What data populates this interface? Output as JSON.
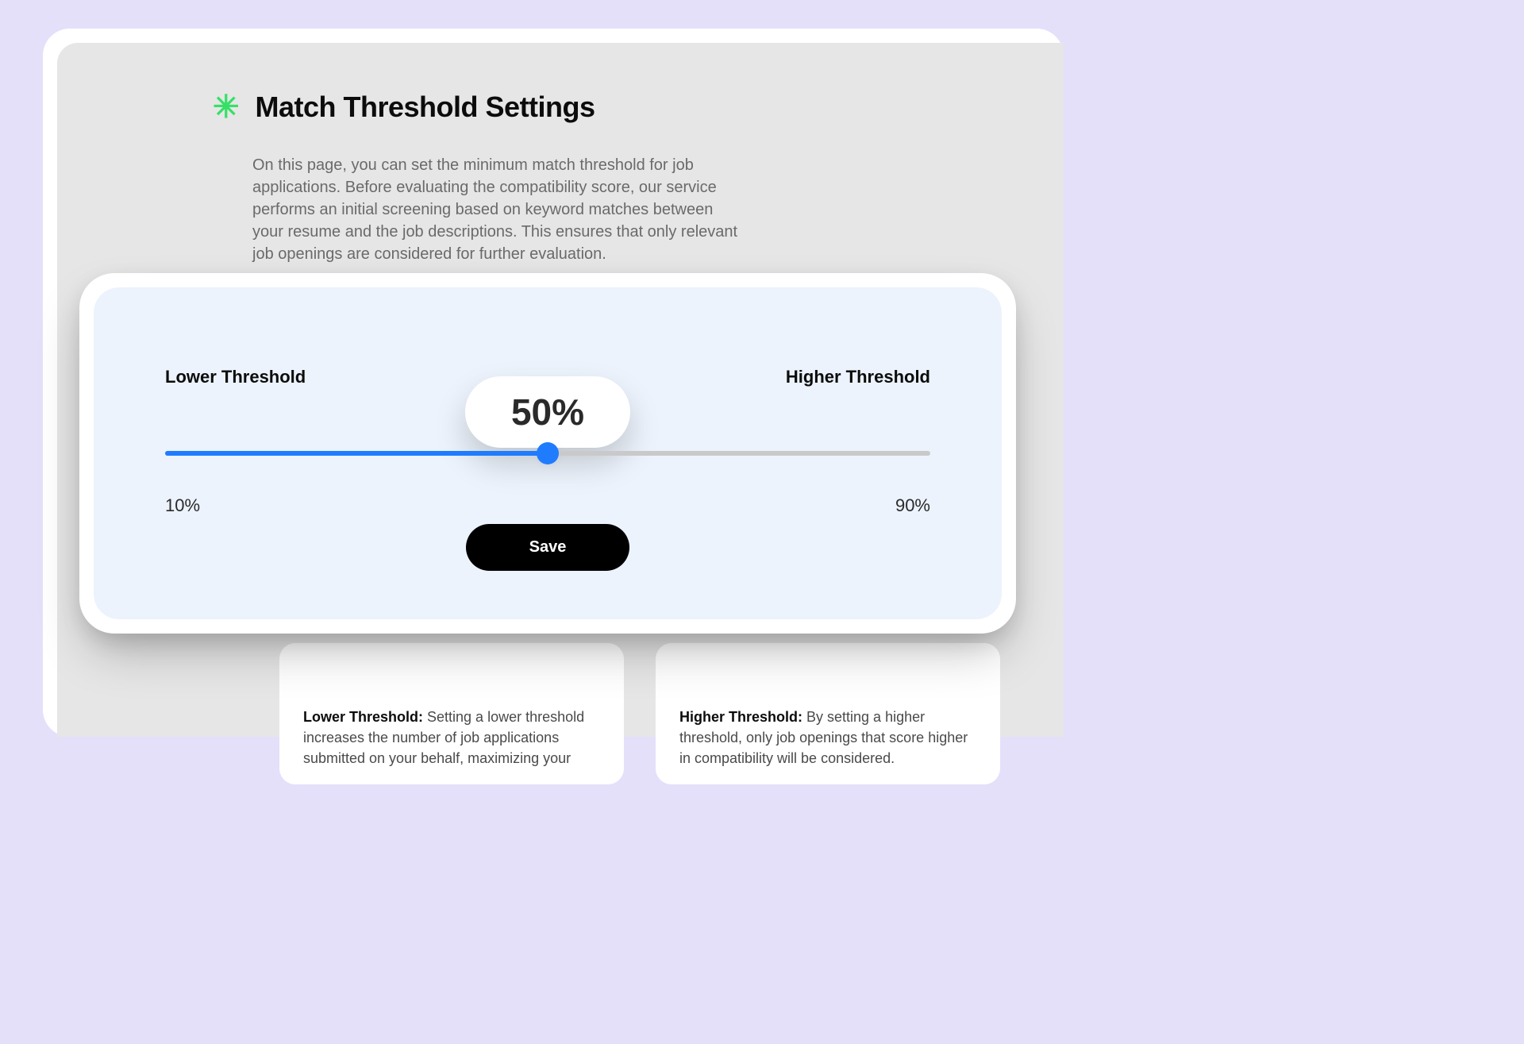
{
  "header": {
    "title": "Match Threshold Settings",
    "description": "On this page, you can set the minimum match threshold for job applications. Before evaluating the compatibility score, our service performs an initial screening based on keyword matches between your resume and the job descriptions. This ensures that only relevant job openings are considered for further evaluation."
  },
  "slider": {
    "lower_label": "Lower Threshold",
    "higher_label": "Higher Threshold",
    "value_display": "50%",
    "value_percent": 50,
    "min_label": "10%",
    "max_label": "90%",
    "save_label": "Save"
  },
  "info": {
    "lower": {
      "label": "Lower Threshold:",
      "text": " Setting a lower threshold increases the number of job applications submitted on your behalf, maximizing your"
    },
    "higher": {
      "label": "Higher Threshold:",
      "text": " By setting a higher threshold, only job openings that score higher in compatibility will be considered."
    }
  },
  "colors": {
    "accent": "#1F7CFF",
    "asterisk": "#35E066",
    "bg_outer": "#E4E0FA",
    "card_tint": "#ECF3FC"
  }
}
